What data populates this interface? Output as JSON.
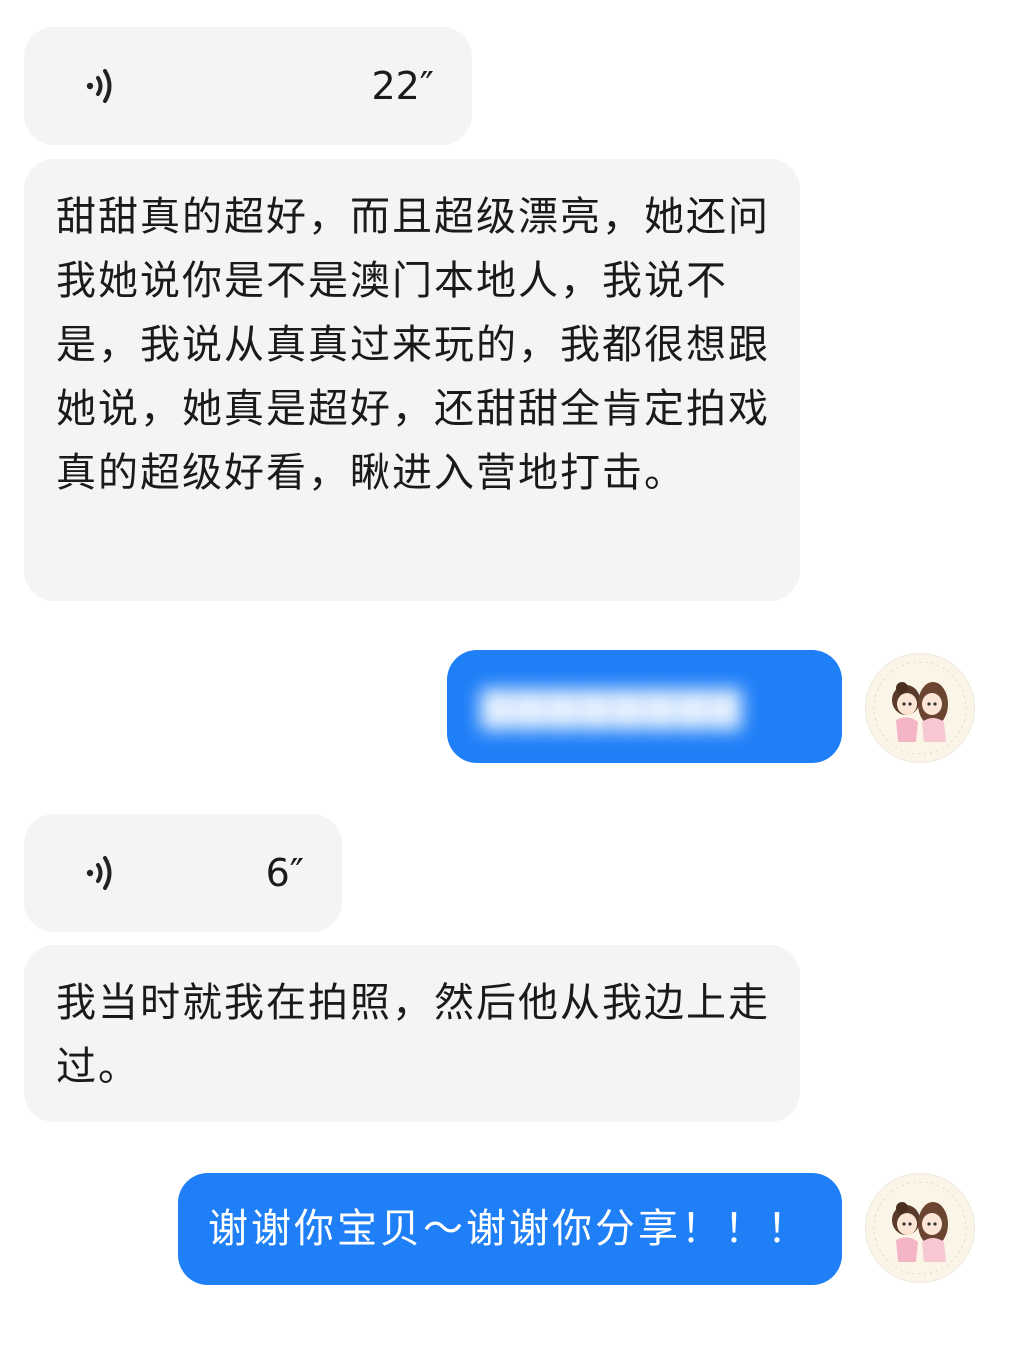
{
  "messages": [
    {
      "type": "voice",
      "direction": "in",
      "duration": "22″"
    },
    {
      "type": "text",
      "direction": "in",
      "text": "甜甜真的超好，而且超级漂亮，她还问我她说你是不是澳门本地人，我说不是，我说从真真过来玩的，我都很想跟她说，她真是超好，还甜甜全肯定拍戏真的超级好看，瞅进入营地打击。"
    },
    {
      "type": "text",
      "direction": "out",
      "text": "",
      "blurred": true
    },
    {
      "type": "voice",
      "direction": "in",
      "duration": "6″"
    },
    {
      "type": "text",
      "direction": "in",
      "text": "我当时就我在拍照，然后他从我边上走过。"
    },
    {
      "type": "text",
      "direction": "out",
      "text": "谢谢你宝贝～谢谢你分享！！！"
    }
  ],
  "colors": {
    "incoming_bubble": "#f4f4f4",
    "outgoing_bubble": "#1f7ff7",
    "text_dark": "#1a1a1a",
    "text_light": "#ffffff"
  },
  "icons": {
    "voice": "voice-wave-icon",
    "avatar": "user-avatar"
  }
}
